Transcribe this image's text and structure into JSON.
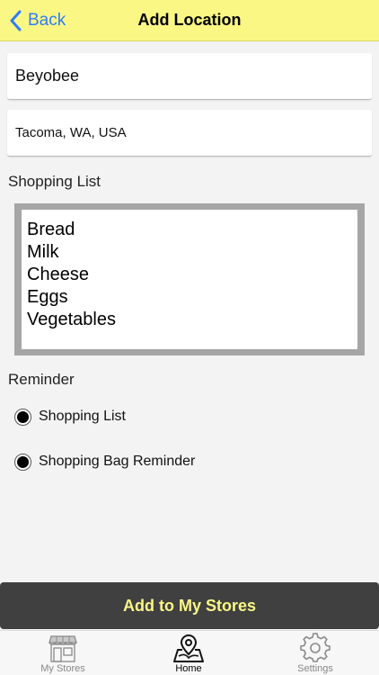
{
  "nav": {
    "back_label": "Back",
    "title": "Add Location"
  },
  "form": {
    "name_value": "Beyobee",
    "address_value": "Tacoma, WA, USA"
  },
  "shopping_list": {
    "label": "Shopping List",
    "items": [
      "Bread",
      "Milk",
      "Cheese",
      "Eggs",
      "Vegetables"
    ]
  },
  "reminder": {
    "label": "Reminder",
    "options": [
      {
        "label": "Shopping List",
        "selected": true
      },
      {
        "label": "Shopping Bag Reminder",
        "selected": true
      }
    ]
  },
  "cta": {
    "label": "Add to My Stores"
  },
  "tabs": [
    {
      "label": "My Stores",
      "icon": "store-icon",
      "active": false
    },
    {
      "label": "Home",
      "icon": "map-pin-icon",
      "active": true
    },
    {
      "label": "Settings",
      "icon": "gear-icon",
      "active": false
    }
  ],
  "colors": {
    "nav_bg": "#fbf785",
    "accent": "#2f7ef6",
    "cta_bg": "#404040",
    "cta_text": "#fbf785"
  }
}
